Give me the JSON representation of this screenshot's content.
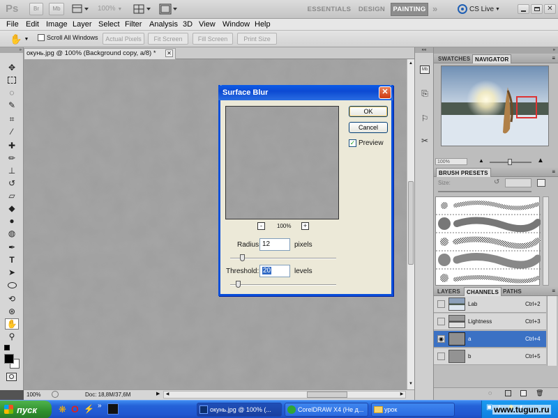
{
  "appbar": {
    "logo": "Ps",
    "zoom": "100%",
    "workspaces": [
      "ESSENTIALS",
      "DESIGN",
      "PAINTING"
    ],
    "cs_live": "CS Live"
  },
  "menu": [
    "File",
    "Edit",
    "Image",
    "Layer",
    "Select",
    "Filter",
    "Analysis",
    "3D",
    "View",
    "Window",
    "Help"
  ],
  "options": {
    "scroll_all": "Scroll All Windows",
    "buttons": [
      "Actual Pixels",
      "Fit Screen",
      "Fill Screen",
      "Print Size"
    ]
  },
  "document": {
    "tab": "окунь.jpg @ 100% (Background copy, a/8) *",
    "zoom": "100%",
    "doc_info": "Doc: 18,8M/37,6M"
  },
  "dialog": {
    "title": "Surface Blur",
    "ok": "OK",
    "cancel": "Cancel",
    "preview_label": "Preview",
    "preview_checked": true,
    "zoom_minus": "-",
    "zoom": "100%",
    "zoom_plus": "+",
    "radius_label": "Radius:",
    "radius_value": "12",
    "radius_unit": "pixels",
    "threshold_label": "Threshold:",
    "threshold_value": "20",
    "threshold_unit": "levels"
  },
  "panels": {
    "top_tabs": [
      "SWATCHES",
      "NAVIGATOR"
    ],
    "navigator_zoom": "100%",
    "brush_tab": "BRUSH PRESETS",
    "brush_size_label": "Size:",
    "layer_tabs": [
      "LAYERS",
      "CHANNELS",
      "PATHS"
    ],
    "channels": [
      {
        "name": "Lab",
        "shortcut": "Ctrl+2",
        "visible": false,
        "selected": false
      },
      {
        "name": "Lightness",
        "shortcut": "Ctrl+3",
        "visible": false,
        "selected": false
      },
      {
        "name": "a",
        "shortcut": "Ctrl+4",
        "visible": true,
        "selected": true
      },
      {
        "name": "b",
        "shortcut": "Ctrl+5",
        "visible": false,
        "selected": false
      }
    ]
  },
  "taskbar": {
    "start": "пуск",
    "tasks": [
      "окунь.jpg @ 100% (...",
      "CorelDRAW X4 (Не д...",
      "урок"
    ],
    "watermark": "www.tugun.ru"
  },
  "colors": {
    "selection_blue": "#3b71c4",
    "xp_title_blue": "#0a5be8",
    "close_red": "#e0502a"
  }
}
